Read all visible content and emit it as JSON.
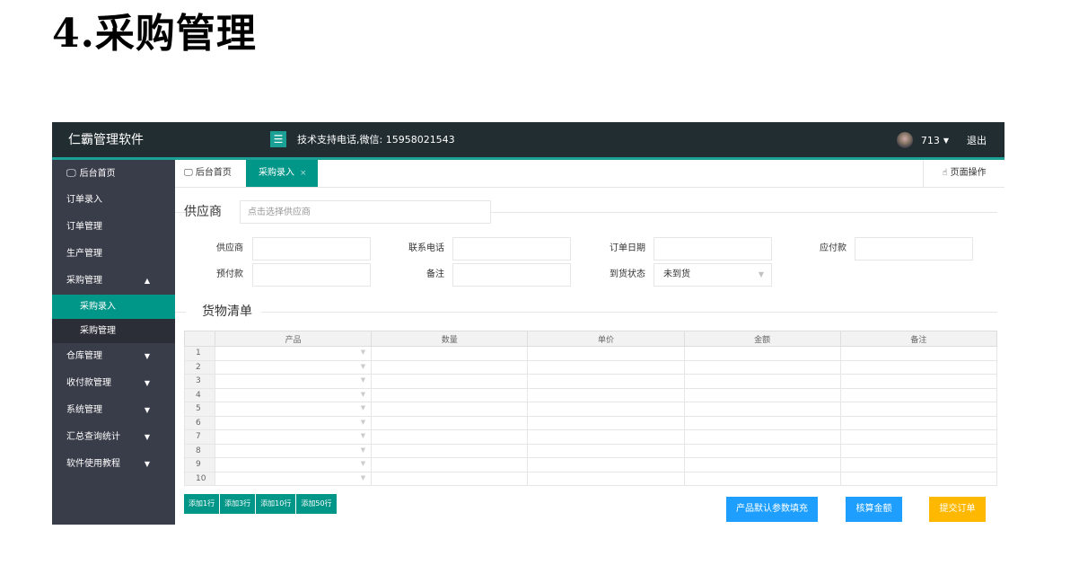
{
  "heading": "4.采购管理",
  "topbar": {
    "brand": "仁霸管理软件",
    "menu_toggle": "☰",
    "support": "技术支持电话,微信: 15958021543",
    "user": "713",
    "logout": "退出"
  },
  "sidebar": {
    "items": [
      {
        "label": "后台首页",
        "icon": "monitor-icon"
      },
      {
        "label": "订单录入"
      },
      {
        "label": "订单管理"
      },
      {
        "label": "生产管理"
      },
      {
        "label": "采购管理",
        "expanded": true
      },
      {
        "label": "采购录入",
        "sub": true,
        "active": true
      },
      {
        "label": "采购管理",
        "sub": true
      },
      {
        "label": "仓库管理"
      },
      {
        "label": "收付款管理"
      },
      {
        "label": "系统管理"
      },
      {
        "label": "汇总查询统计"
      },
      {
        "label": "软件使用教程"
      }
    ]
  },
  "tabs": {
    "home": "后台首页",
    "active": "采购录入",
    "close": "×",
    "page_ops": "页面操作"
  },
  "form": {
    "supplier_legend": "供应商",
    "supplier_placeholder": "点击选择供应商",
    "fields": {
      "supplier": "供应商",
      "phone": "联系电话",
      "order_date": "订单日期",
      "payable": "应付款",
      "prepaid": "预付款",
      "remark": "备注",
      "arrival_status": "到货状态",
      "arrival_status_value": "未到货"
    },
    "goods_legend": "货物清单"
  },
  "grid": {
    "columns": [
      "产品",
      "数量",
      "单价",
      "金额",
      "备注"
    ],
    "rows": [
      "1",
      "2",
      "3",
      "4",
      "5",
      "6",
      "7",
      "8",
      "9",
      "10"
    ]
  },
  "buttons": {
    "add1": "添加1行",
    "add3": "添加3行",
    "add10": "添加10行",
    "add50": "添加50行",
    "fill_defaults": "产品默认参数填充",
    "calc_amount": "核算金额",
    "submit": "提交订单"
  },
  "colors": {
    "topbar": "#222d32",
    "sidebar": "#393d49",
    "accent": "#009688",
    "blue": "#1e9fff",
    "yellow": "#ffb800"
  }
}
